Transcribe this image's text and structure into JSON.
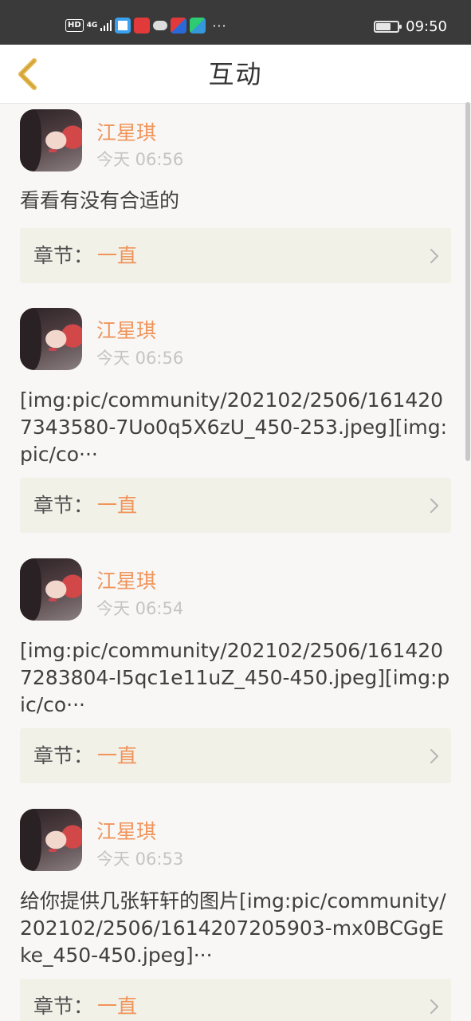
{
  "status_bar": {
    "network_badge": "HD",
    "network_type": "4G",
    "apps": [
      "browser-app-icon",
      "heart-app-icon",
      "cloud-icon",
      "video-app-icon",
      "tencent-video-icon"
    ],
    "more": "···",
    "battery_level": 0.7,
    "time": "09:50"
  },
  "nav": {
    "title": "互动",
    "back_icon": "chevron-left-icon"
  },
  "posts": [
    {
      "username": "江星琪",
      "time": "今天 06:56",
      "text": "看看有没有合适的",
      "chapter_label": "章节：",
      "chapter_name": "一直"
    },
    {
      "username": "江星琪",
      "time": "今天 06:56",
      "text": "[img:pic/community/202102/2506/1614207343580-7Uo0q5X6zU_450-253.jpeg][img:pic/co···",
      "chapter_label": "章节：",
      "chapter_name": "一直"
    },
    {
      "username": "江星琪",
      "time": "今天 06:54",
      "text": "[img:pic/community/202102/2506/1614207283804-I5qc1e11uZ_450-450.jpeg][img:pic/co···",
      "chapter_label": "章节：",
      "chapter_name": "一直"
    },
    {
      "username": "江星琪",
      "time": "今天 06:53",
      "text": "给你提供几张轩轩的图片[img:pic/community/202102/2506/1614207205903-mx0BCGgEke_450-450.jpeg]···",
      "chapter_label": "章节：",
      "chapter_name": "一直"
    }
  ],
  "colors": {
    "accent": "#f0945a",
    "back_arrow": "#e3b54a",
    "chapter_bg": "#f1f1e8",
    "status_bar_bg": "#3a3a3a"
  }
}
